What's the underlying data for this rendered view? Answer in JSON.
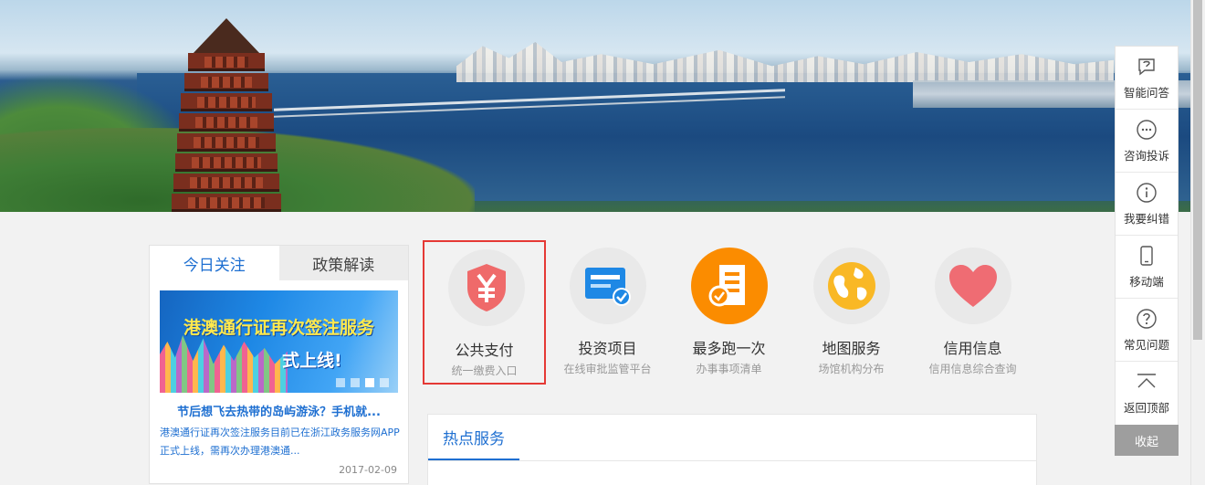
{
  "news_box": {
    "tabs": [
      {
        "label": "今日关注"
      },
      {
        "label": "政策解读"
      }
    ],
    "image_title_line1": "港澳通行证再次签注服务",
    "image_title_line2": "式上线!",
    "headline": "节后想飞去热带的岛屿游泳？手机就...",
    "summary": "港澳通行证再次签注服务目前已在浙江政务服务网APP正式上线，需再次办理港澳通...",
    "date": "2017-02-09"
  },
  "services": [
    {
      "name": "公共支付",
      "sub": "统一缴费入口",
      "icon": "yuan-shield-icon",
      "color": "#ef5350"
    },
    {
      "name": "投资项目",
      "sub": "在线审批监管平台",
      "icon": "investment-card-icon",
      "color": "#1e88e5"
    },
    {
      "name": "最多跑一次",
      "sub": "办事事项清单",
      "icon": "document-check-icon",
      "color": "#fb8c00"
    },
    {
      "name": "地图服务",
      "sub": "场馆机构分布",
      "icon": "globe-icon",
      "color": "#f9a825"
    },
    {
      "name": "信用信息",
      "sub": "信用信息综合查询",
      "icon": "heart-icon",
      "color": "#ef6c73"
    }
  ],
  "hot_services": {
    "tab_label": "热点服务"
  },
  "sidebar": {
    "items": [
      {
        "label": "智能问答",
        "icon": "chat-answer-icon"
      },
      {
        "label": "咨询投诉",
        "icon": "message-dots-icon"
      },
      {
        "label": "我要纠错",
        "icon": "info-icon"
      },
      {
        "label": "移动端",
        "icon": "mobile-phone-icon"
      },
      {
        "label": "常见问题",
        "icon": "question-icon"
      },
      {
        "label": "返回顶部",
        "icon": "back-to-top-icon"
      }
    ],
    "collapse_label": "收起"
  }
}
